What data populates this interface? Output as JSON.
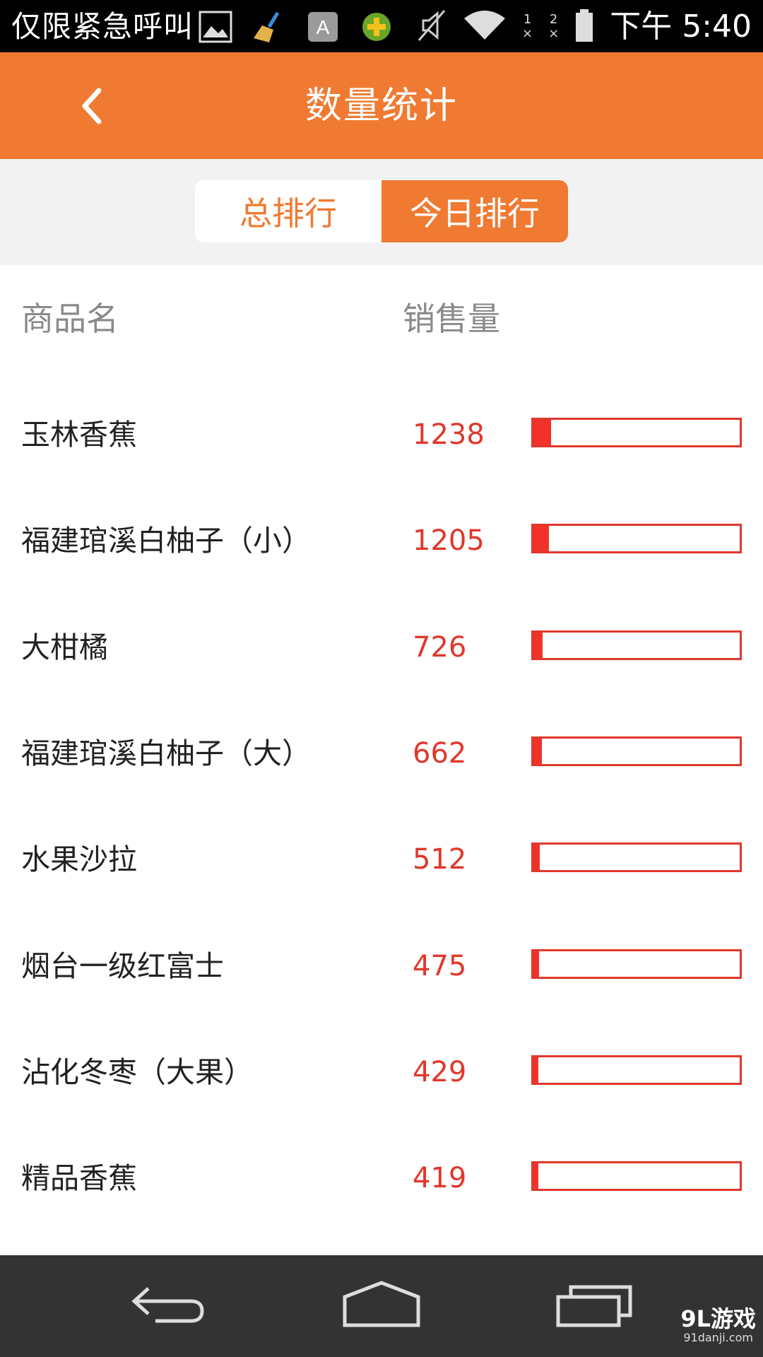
{
  "status_bar": {
    "carrier_text": "仅限紧急呼叫",
    "sim1": "1",
    "sim2": "2",
    "time": "下午 5:40",
    "icons": [
      "image-icon",
      "broom-icon",
      "a-icon",
      "plus-shield-icon",
      "mute-icon",
      "wifi-icon",
      "signal1-icon",
      "signal2-icon",
      "battery-icon"
    ]
  },
  "header": {
    "title": "数量统计",
    "back_icon": "chevron-left-icon"
  },
  "tabs": [
    {
      "label": "总排行",
      "active": false
    },
    {
      "label": "今日排行",
      "active": true
    }
  ],
  "columns": {
    "name": "商品名",
    "sales": "销售量"
  },
  "rows": [
    {
      "name": "玉林香蕉",
      "sales": "1238",
      "fill": 0.085
    },
    {
      "name": "福建琯溪白柚子（小）",
      "sales": "1205",
      "fill": 0.075
    },
    {
      "name": "大柑橘",
      "sales": "726",
      "fill": 0.045
    },
    {
      "name": "福建琯溪白柚子（大）",
      "sales": "662",
      "fill": 0.04
    },
    {
      "name": "水果沙拉",
      "sales": "512",
      "fill": 0.03
    },
    {
      "name": "烟台一级红富士",
      "sales": "475",
      "fill": 0.028
    },
    {
      "name": "沾化冬枣（大果）",
      "sales": "429",
      "fill": 0.025
    },
    {
      "name": "精品香蕉",
      "sales": "419",
      "fill": 0.025
    }
  ],
  "nav": {
    "back_icon": "back-icon",
    "home_icon": "home-icon",
    "recents_icon": "recents-icon"
  },
  "watermark": {
    "main": "9L游戏",
    "sub": "91danji.com"
  },
  "colors": {
    "accent": "#f07a32",
    "bar": "#e0382c"
  }
}
